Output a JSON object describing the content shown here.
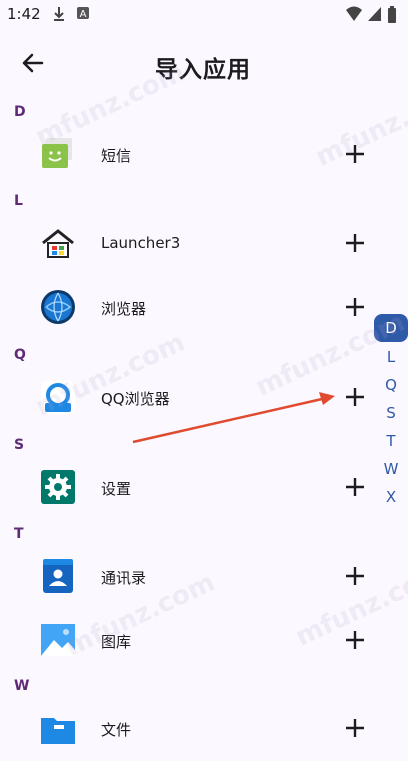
{
  "status_bar": {
    "time": "1:42",
    "icons": [
      "download-icon",
      "a-square-icon",
      "wifi-icon",
      "signal-icon",
      "battery-icon"
    ]
  },
  "app_bar": {
    "title": "导入应用",
    "back_icon": "arrow-back-icon"
  },
  "sections": [
    {
      "letter": "D",
      "apps": [
        {
          "name": "短信",
          "icon": "messaging-icon"
        }
      ]
    },
    {
      "letter": "L",
      "apps": [
        {
          "name": "Launcher3",
          "icon": "launcher-icon"
        },
        {
          "name": "浏览器",
          "icon": "browser-globe-icon"
        }
      ]
    },
    {
      "letter": "Q",
      "apps": [
        {
          "name": "QQ浏览器",
          "icon": "qq-browser-icon"
        }
      ]
    },
    {
      "letter": "S",
      "apps": [
        {
          "name": "设置",
          "icon": "settings-gear-icon"
        }
      ]
    },
    {
      "letter": "T",
      "apps": [
        {
          "name": "通讯录",
          "icon": "contacts-icon"
        },
        {
          "name": "图库",
          "icon": "gallery-icon"
        }
      ]
    },
    {
      "letter": "W",
      "apps": [
        {
          "name": "文件",
          "icon": "files-folder-icon"
        }
      ]
    }
  ],
  "index_letters": [
    "D",
    "L",
    "Q",
    "S",
    "T",
    "W",
    "X"
  ],
  "active_index": "D",
  "watermark": "mfunz.com",
  "colors": {
    "accent": "#2f5aa8",
    "section": "#5f2b76",
    "background": "#fbf8ff",
    "annotation_arrow": "#e04a2f"
  }
}
